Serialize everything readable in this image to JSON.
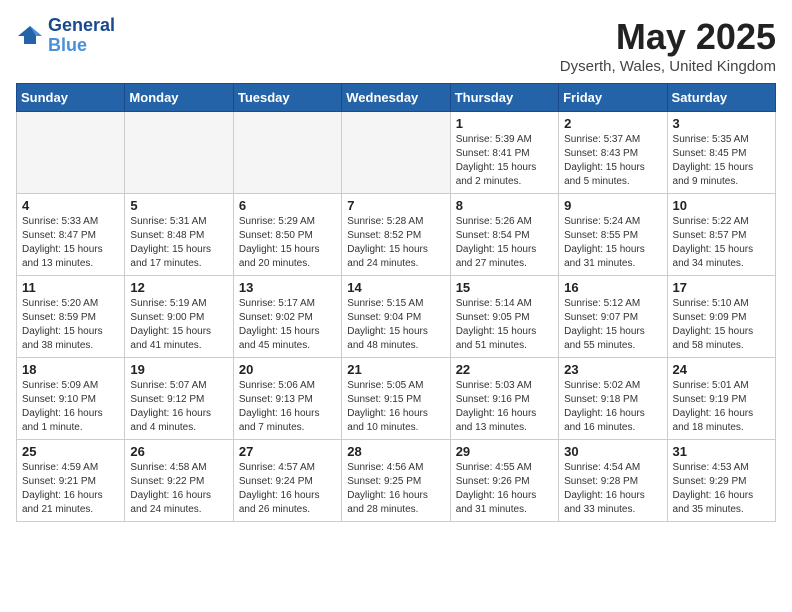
{
  "logo": {
    "line1": "General",
    "line2": "Blue"
  },
  "title": "May 2025",
  "location": "Dyserth, Wales, United Kingdom",
  "weekdays": [
    "Sunday",
    "Monday",
    "Tuesday",
    "Wednesday",
    "Thursday",
    "Friday",
    "Saturday"
  ],
  "weeks": [
    [
      {
        "day": "",
        "info": ""
      },
      {
        "day": "",
        "info": ""
      },
      {
        "day": "",
        "info": ""
      },
      {
        "day": "",
        "info": ""
      },
      {
        "day": "1",
        "info": "Sunrise: 5:39 AM\nSunset: 8:41 PM\nDaylight: 15 hours\nand 2 minutes."
      },
      {
        "day": "2",
        "info": "Sunrise: 5:37 AM\nSunset: 8:43 PM\nDaylight: 15 hours\nand 5 minutes."
      },
      {
        "day": "3",
        "info": "Sunrise: 5:35 AM\nSunset: 8:45 PM\nDaylight: 15 hours\nand 9 minutes."
      }
    ],
    [
      {
        "day": "4",
        "info": "Sunrise: 5:33 AM\nSunset: 8:47 PM\nDaylight: 15 hours\nand 13 minutes."
      },
      {
        "day": "5",
        "info": "Sunrise: 5:31 AM\nSunset: 8:48 PM\nDaylight: 15 hours\nand 17 minutes."
      },
      {
        "day": "6",
        "info": "Sunrise: 5:29 AM\nSunset: 8:50 PM\nDaylight: 15 hours\nand 20 minutes."
      },
      {
        "day": "7",
        "info": "Sunrise: 5:28 AM\nSunset: 8:52 PM\nDaylight: 15 hours\nand 24 minutes."
      },
      {
        "day": "8",
        "info": "Sunrise: 5:26 AM\nSunset: 8:54 PM\nDaylight: 15 hours\nand 27 minutes."
      },
      {
        "day": "9",
        "info": "Sunrise: 5:24 AM\nSunset: 8:55 PM\nDaylight: 15 hours\nand 31 minutes."
      },
      {
        "day": "10",
        "info": "Sunrise: 5:22 AM\nSunset: 8:57 PM\nDaylight: 15 hours\nand 34 minutes."
      }
    ],
    [
      {
        "day": "11",
        "info": "Sunrise: 5:20 AM\nSunset: 8:59 PM\nDaylight: 15 hours\nand 38 minutes."
      },
      {
        "day": "12",
        "info": "Sunrise: 5:19 AM\nSunset: 9:00 PM\nDaylight: 15 hours\nand 41 minutes."
      },
      {
        "day": "13",
        "info": "Sunrise: 5:17 AM\nSunset: 9:02 PM\nDaylight: 15 hours\nand 45 minutes."
      },
      {
        "day": "14",
        "info": "Sunrise: 5:15 AM\nSunset: 9:04 PM\nDaylight: 15 hours\nand 48 minutes."
      },
      {
        "day": "15",
        "info": "Sunrise: 5:14 AM\nSunset: 9:05 PM\nDaylight: 15 hours\nand 51 minutes."
      },
      {
        "day": "16",
        "info": "Sunrise: 5:12 AM\nSunset: 9:07 PM\nDaylight: 15 hours\nand 55 minutes."
      },
      {
        "day": "17",
        "info": "Sunrise: 5:10 AM\nSunset: 9:09 PM\nDaylight: 15 hours\nand 58 minutes."
      }
    ],
    [
      {
        "day": "18",
        "info": "Sunrise: 5:09 AM\nSunset: 9:10 PM\nDaylight: 16 hours\nand 1 minute."
      },
      {
        "day": "19",
        "info": "Sunrise: 5:07 AM\nSunset: 9:12 PM\nDaylight: 16 hours\nand 4 minutes."
      },
      {
        "day": "20",
        "info": "Sunrise: 5:06 AM\nSunset: 9:13 PM\nDaylight: 16 hours\nand 7 minutes."
      },
      {
        "day": "21",
        "info": "Sunrise: 5:05 AM\nSunset: 9:15 PM\nDaylight: 16 hours\nand 10 minutes."
      },
      {
        "day": "22",
        "info": "Sunrise: 5:03 AM\nSunset: 9:16 PM\nDaylight: 16 hours\nand 13 minutes."
      },
      {
        "day": "23",
        "info": "Sunrise: 5:02 AM\nSunset: 9:18 PM\nDaylight: 16 hours\nand 16 minutes."
      },
      {
        "day": "24",
        "info": "Sunrise: 5:01 AM\nSunset: 9:19 PM\nDaylight: 16 hours\nand 18 minutes."
      }
    ],
    [
      {
        "day": "25",
        "info": "Sunrise: 4:59 AM\nSunset: 9:21 PM\nDaylight: 16 hours\nand 21 minutes."
      },
      {
        "day": "26",
        "info": "Sunrise: 4:58 AM\nSunset: 9:22 PM\nDaylight: 16 hours\nand 24 minutes."
      },
      {
        "day": "27",
        "info": "Sunrise: 4:57 AM\nSunset: 9:24 PM\nDaylight: 16 hours\nand 26 minutes."
      },
      {
        "day": "28",
        "info": "Sunrise: 4:56 AM\nSunset: 9:25 PM\nDaylight: 16 hours\nand 28 minutes."
      },
      {
        "day": "29",
        "info": "Sunrise: 4:55 AM\nSunset: 9:26 PM\nDaylight: 16 hours\nand 31 minutes."
      },
      {
        "day": "30",
        "info": "Sunrise: 4:54 AM\nSunset: 9:28 PM\nDaylight: 16 hours\nand 33 minutes."
      },
      {
        "day": "31",
        "info": "Sunrise: 4:53 AM\nSunset: 9:29 PM\nDaylight: 16 hours\nand 35 minutes."
      }
    ]
  ]
}
